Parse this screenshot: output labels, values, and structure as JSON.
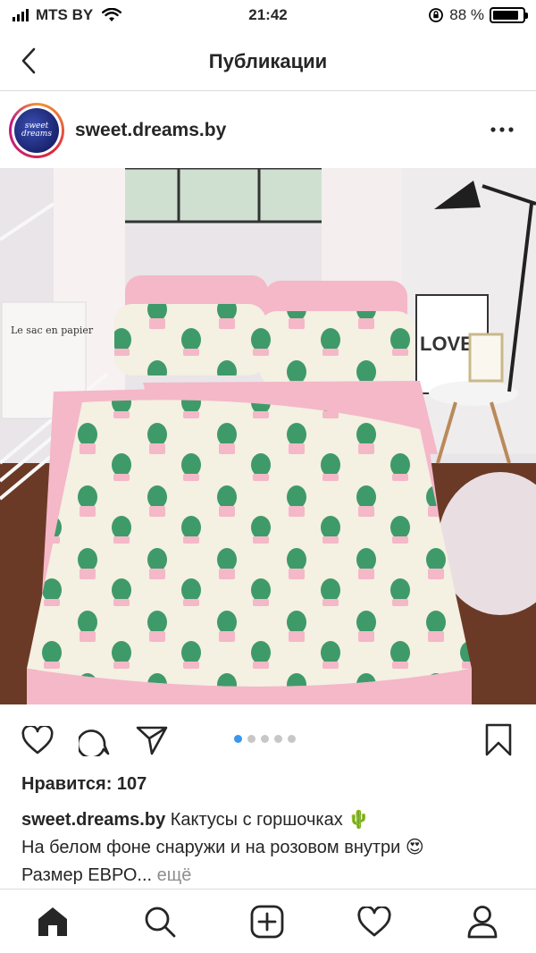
{
  "status_bar": {
    "carrier": "MTS BY",
    "time": "21:42",
    "battery_percent": "88 %",
    "battery_level": 0.88
  },
  "header": {
    "title": "Публикации",
    "back_icon": "chevron-left-icon"
  },
  "post": {
    "username": "sweet.dreams.by",
    "avatar_text_line1": "sweet",
    "avatar_text_line2": "dreams",
    "more_icon": "more-horizontal-icon",
    "photo_label": "Le sac en papier",
    "photo_love": "LOVE",
    "carousel": {
      "count": 5,
      "active": 1
    },
    "likes": "Нравится: 107",
    "caption_username": "sweet.dreams.by",
    "caption_line1": "Кактусы с горшочках 🌵",
    "caption_line2": "На белом фоне снаружи и на розовом внутри 😍",
    "caption_line3": "Размер ЕВРО...",
    "caption_more": "ещё"
  },
  "actions": {
    "like_icon": "heart-icon",
    "comment_icon": "comment-icon",
    "share_icon": "send-icon",
    "save_icon": "bookmark-icon"
  },
  "tab_bar": [
    {
      "name": "home",
      "icon": "home-icon"
    },
    {
      "name": "search",
      "icon": "search-icon"
    },
    {
      "name": "new-post",
      "icon": "add-post-icon"
    },
    {
      "name": "activity",
      "icon": "heart-icon"
    },
    {
      "name": "profile",
      "icon": "profile-icon"
    }
  ],
  "colors": {
    "accent": "#3897f0",
    "text": "#262626",
    "muted": "#8e8e8e",
    "divider": "#dbdbdb",
    "bed_pink": "#f4b8c8",
    "cactus_green": "#3f9a6a"
  }
}
